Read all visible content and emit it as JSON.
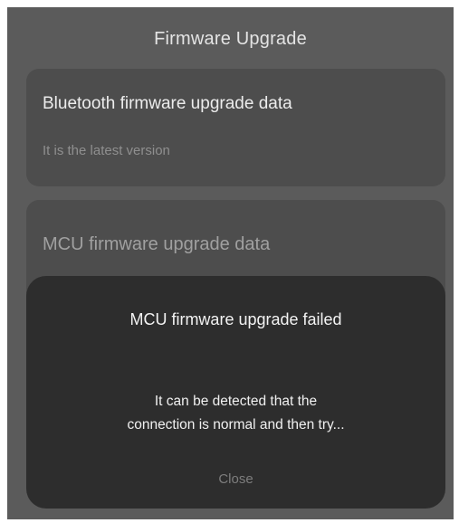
{
  "header": {
    "title": "Firmware Upgrade"
  },
  "bluetooth_card": {
    "title": "Bluetooth firmware upgrade data",
    "status": "It is the latest version"
  },
  "mcu_card": {
    "title": "MCU firmware upgrade data"
  },
  "dialog": {
    "title": "MCU firmware upgrade failed",
    "message_line1": "It can be detected that the",
    "message_line2": "connection is normal and then try...",
    "close_label": "Close"
  },
  "colors": {
    "screen_background": "#5b5b5b",
    "card_background": "#4d4d4d",
    "dialog_background": "#2d2d2d",
    "muted_text": "#8f8f8f"
  }
}
